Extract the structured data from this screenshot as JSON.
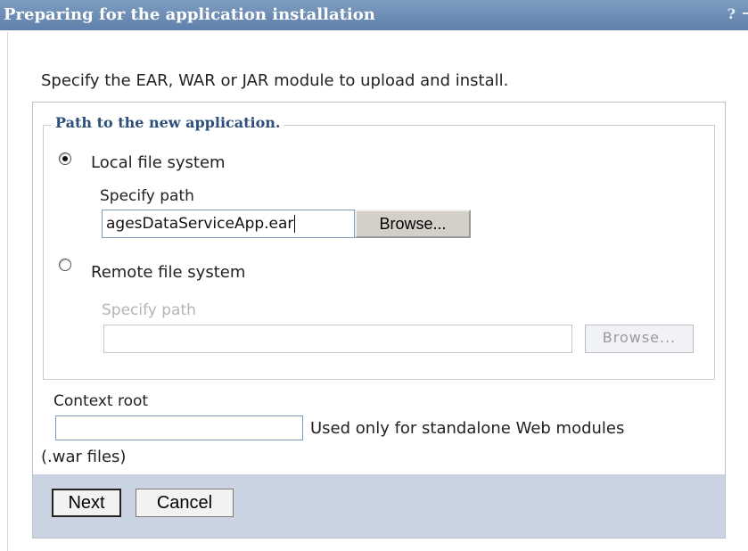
{
  "window": {
    "title": "Preparing for the application installation",
    "help_glyph": "?"
  },
  "instruction": "Specify the EAR, WAR or JAR module to upload and install.",
  "path_group": {
    "legend": "Path to the new application.",
    "local": {
      "label": "Local file system",
      "selected": true,
      "path_label": "Specify path",
      "path_value": "agesDataServiceApp.ear",
      "browse_label": "Browse..."
    },
    "remote": {
      "label": "Remote file system",
      "selected": false,
      "path_label": "Specify path",
      "path_value": "",
      "browse_label": "Browse..."
    }
  },
  "context_root": {
    "label": "Context root",
    "value": "",
    "hint": "Used only for standalone Web modules",
    "hint_continued": "(.war files)"
  },
  "actions": {
    "next_label": "Next",
    "cancel_label": "Cancel"
  },
  "colors": {
    "titlebar": "#6d8db8",
    "legend_text": "#2d4f7a",
    "button_bar": "#c9d3e1"
  },
  "icons": {
    "help": "help-icon",
    "minimize": "minimize-icon"
  }
}
